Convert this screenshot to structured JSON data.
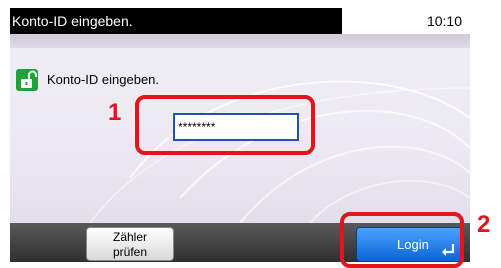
{
  "window": {
    "title": "Konto-ID eingeben.",
    "clock": "10:10"
  },
  "content": {
    "prompt": "Konto-ID eingeben.",
    "lock_icon": "unlocked-padlock-icon",
    "password": {
      "value": "********"
    }
  },
  "buttons": {
    "counter_line1": "Zähler",
    "counter_line2": "prüfen",
    "login": "Login",
    "login_icon": "enter-icon"
  },
  "callouts": {
    "one": "1",
    "two": "2"
  },
  "colors": {
    "callout": "#e2141c",
    "login_button": "#1477e6",
    "lock_icon": "#22a13a",
    "title_bar": "#000000"
  }
}
